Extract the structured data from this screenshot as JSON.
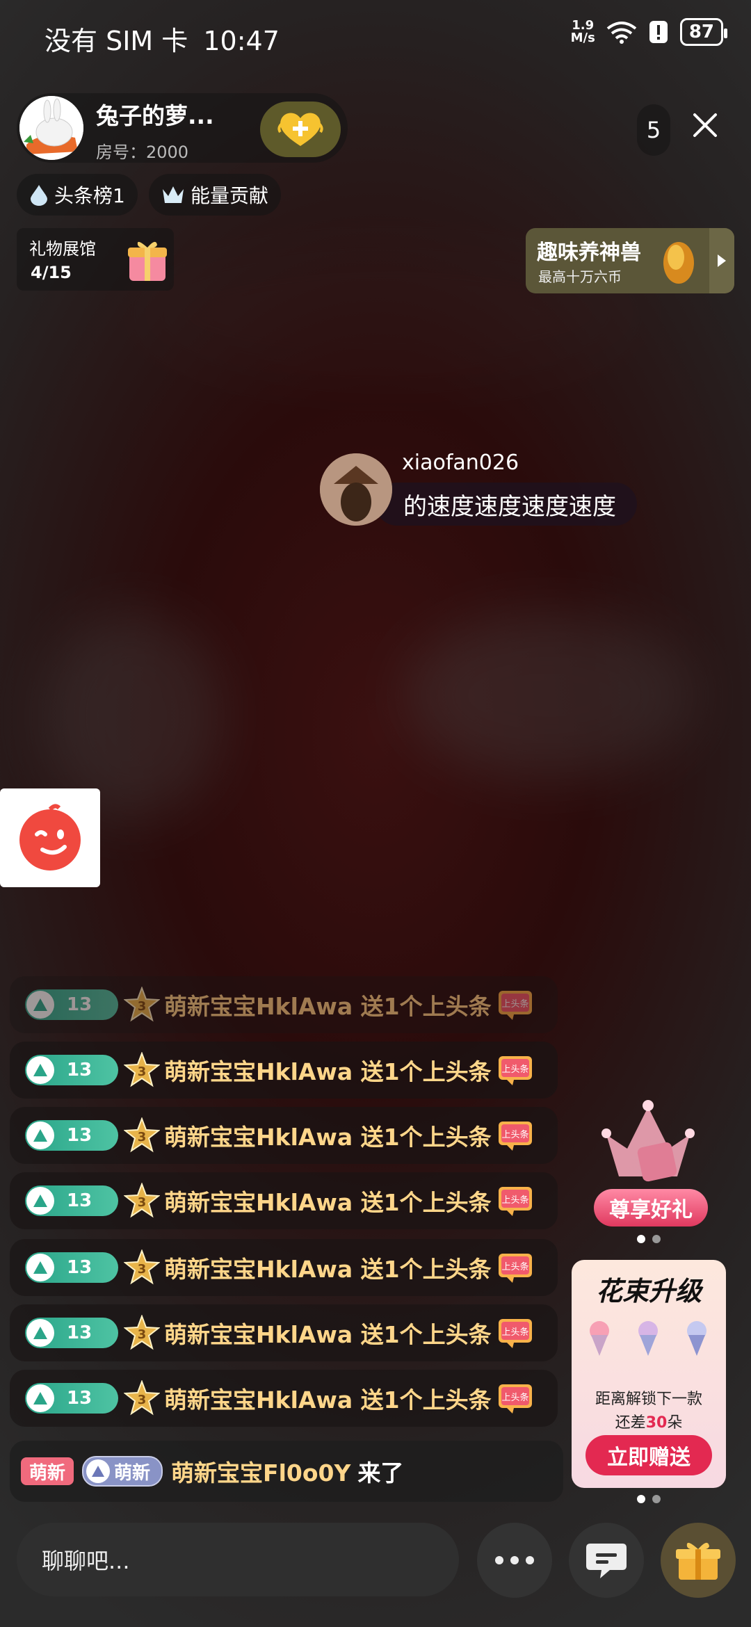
{
  "status_bar": {
    "carrier": "没有 SIM 卡",
    "time": "10:47",
    "net_speed_value": "1.9",
    "net_speed_unit": "M/s",
    "battery": "87"
  },
  "room": {
    "name": "兔子的萝...",
    "id_label": "房号：2000",
    "viewer_count": "5"
  },
  "chips": {
    "headline": "头条榜1",
    "energy": "能量贡献"
  },
  "gift_hall": {
    "label": "礼物展馆",
    "progress": "4/15"
  },
  "beast_banner": {
    "title": "趣味养神兽",
    "subtitle": "最高十万六币"
  },
  "comment": {
    "user": "xiaofan026",
    "text": "的速度速度速度速度"
  },
  "gift_messages": [
    {
      "level": "13",
      "star_level": "3",
      "text": "萌新宝宝HklAwa 送1个上头条",
      "tag": "上头条"
    },
    {
      "level": "13",
      "star_level": "3",
      "text": "萌新宝宝HklAwa 送1个上头条",
      "tag": "上头条"
    },
    {
      "level": "13",
      "star_level": "3",
      "text": "萌新宝宝HklAwa 送1个上头条",
      "tag": "上头条"
    },
    {
      "level": "13",
      "star_level": "3",
      "text": "萌新宝宝HklAwa 送1个上头条",
      "tag": "上头条"
    },
    {
      "level": "13",
      "star_level": "3",
      "text": "萌新宝宝HklAwa 送1个上头条",
      "tag": "上头条"
    },
    {
      "level": "13",
      "star_level": "3",
      "text": "萌新宝宝HklAwa 送1个上头条",
      "tag": "上头条"
    },
    {
      "level": "13",
      "star_level": "3",
      "text": "萌新宝宝HklAwa 送1个上头条",
      "tag": "上头条"
    }
  ],
  "welcome": {
    "tag1": "萌新",
    "tag2": "萌新",
    "user": "萌新宝宝Fl0o0Y",
    "action": "来了"
  },
  "promo": {
    "enjoy_label": "尊享好礼",
    "flower_title": "花束升级",
    "flower_line1": "距离解锁下一款",
    "flower_line2_prefix": "还差",
    "flower_line2_count": "30",
    "flower_line2_suffix": "朵",
    "send_label": "立即赠送"
  },
  "bottom": {
    "chat_placeholder": "聊聊吧..."
  },
  "colors": {
    "gift_text": "#ffd68a",
    "send_button": "#e32951",
    "level_badge": "#2aa589"
  }
}
